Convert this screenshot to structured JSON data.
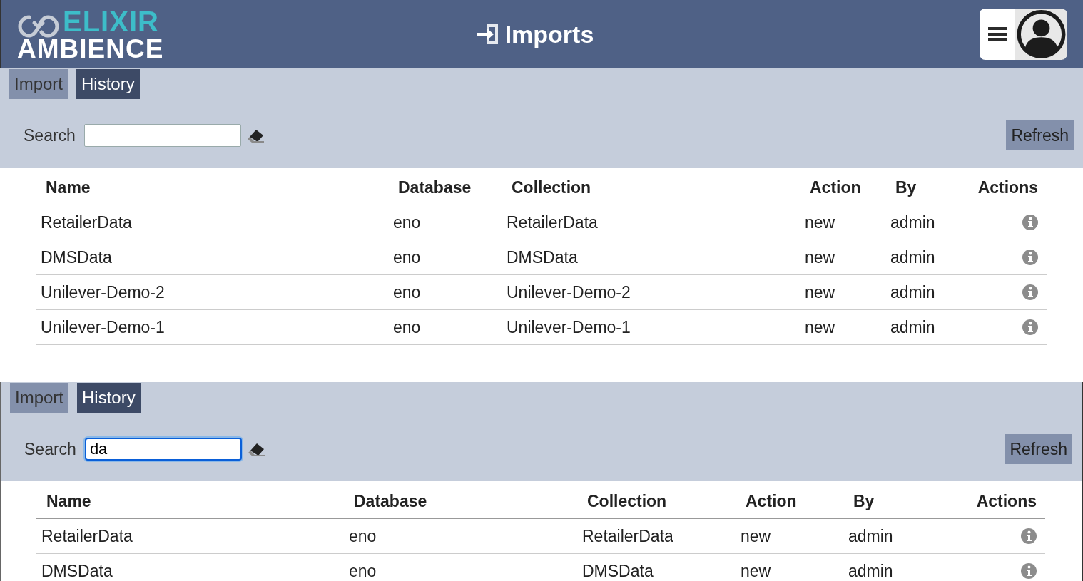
{
  "header": {
    "logo_top": "ELIXIR",
    "logo_bottom": "AMBIENCE",
    "title": "Imports"
  },
  "panels": [
    {
      "tabs": [
        {
          "label": "Import",
          "selected": false
        },
        {
          "label": "History",
          "selected": true
        }
      ],
      "search": {
        "label": "Search",
        "focused": false
      },
      "refresh": "Refresh",
      "columns": [
        "Name",
        "Database",
        "Collection",
        "Action",
        "By",
        "Actions"
      ],
      "rows": [
        {
          "name": "RetailerData",
          "database": "eno",
          "collection": "RetailerData",
          "action": "new",
          "by": "admin"
        },
        {
          "name": "DMSData",
          "database": "eno",
          "collection": "DMSData",
          "action": "new",
          "by": "admin"
        },
        {
          "name": "Unilever-Demo-2",
          "database": "eno",
          "collection": "Unilever-Demo-2",
          "action": "new",
          "by": "admin"
        },
        {
          "name": "Unilever-Demo-1",
          "database": "eno",
          "collection": "Unilever-Demo-1",
          "action": "new",
          "by": "admin"
        }
      ]
    },
    {
      "tabs": [
        {
          "label": "Import",
          "selected": false
        },
        {
          "label": "History",
          "selected": true
        }
      ],
      "search": {
        "label": "Search",
        "value": "da",
        "focused": true
      },
      "refresh": "Refresh",
      "columns": [
        "Name",
        "Database",
        "Collection",
        "Action",
        "By",
        "Actions"
      ],
      "rows": [
        {
          "name": "RetailerData",
          "database": "eno",
          "collection": "RetailerData",
          "action": "new",
          "by": "admin"
        },
        {
          "name": "DMSData",
          "database": "eno",
          "collection": "DMSData",
          "action": "new",
          "by": "admin"
        }
      ]
    }
  ]
}
